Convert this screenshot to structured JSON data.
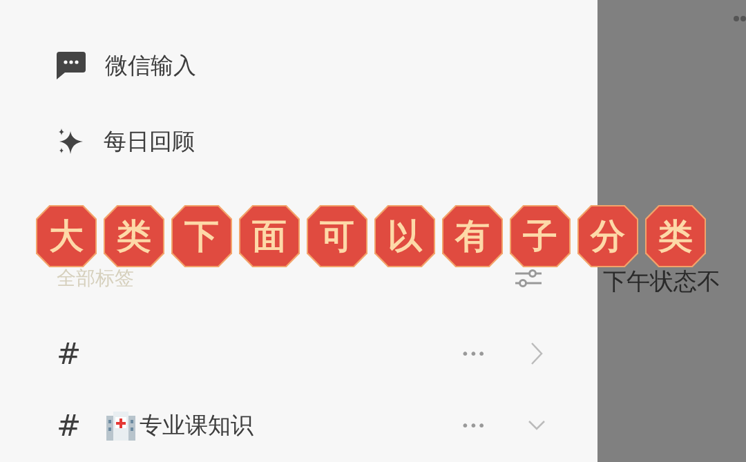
{
  "sidebar": {
    "nav_items": [
      {
        "kind": "chat",
        "label": "微信输入"
      },
      {
        "kind": "sparkle",
        "label": "每日回顾"
      }
    ],
    "tags_header": {
      "title": "全部标签"
    },
    "tags": [
      {
        "prefix": "#",
        "expanded": false,
        "more": "•••"
      },
      {
        "prefix": "#",
        "kind": "hospital",
        "name": "专业课知识",
        "expanded": true,
        "more": "•••"
      }
    ]
  },
  "main_panel": {
    "snippet": "下午状态不"
  },
  "caption": "大类下面可以有子分类"
}
